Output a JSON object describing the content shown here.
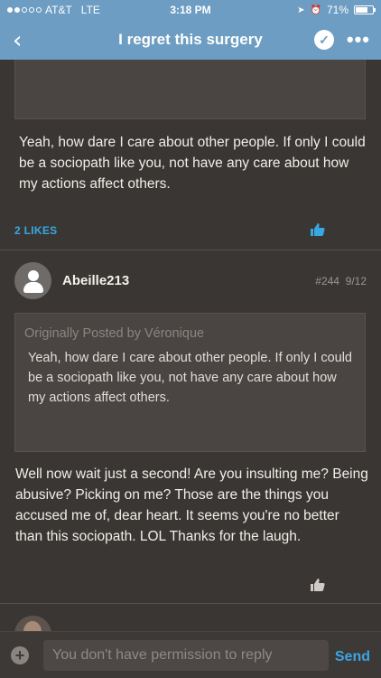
{
  "status": {
    "carrier": "AT&T",
    "network": "LTE",
    "time": "3:18 PM",
    "battery": "71%",
    "battery_level": 0.71
  },
  "header": {
    "title": "I regret this surgery"
  },
  "posts": [
    {
      "body": "Yeah, how dare I care about other people. If only I could be a sociopath like you, not have any care about how my actions affect others.",
      "likes": "2 LIKES"
    },
    {
      "username": "Abeille213",
      "post_num": "#244",
      "date": "9/12",
      "quote_by": "Originally Posted by Véronique",
      "quote_text": "Yeah, how dare I care about other people. If only I could be a sociopath like you, not have any care about how my actions affect others.",
      "body": "Well now wait just a second! Are you insulting me? Being abusive? Picking on me? Those are the things you accused me of, dear heart. It seems you're no better than this sociopath. LOL Thanks for the laugh."
    }
  ],
  "reply": {
    "placeholder": "You don't have permission to reply",
    "send_label": "Send"
  },
  "colors": {
    "header": "#6d9dc2",
    "background": "#3a3633",
    "accent": "#37a8e0"
  },
  "icons": [
    "back-icon",
    "check-icon",
    "more-icon",
    "thumbs-up-icon",
    "user-avatar-icon",
    "plus-icon",
    "signal-dots-icon",
    "location-icon",
    "alarm-icon",
    "battery-icon"
  ]
}
